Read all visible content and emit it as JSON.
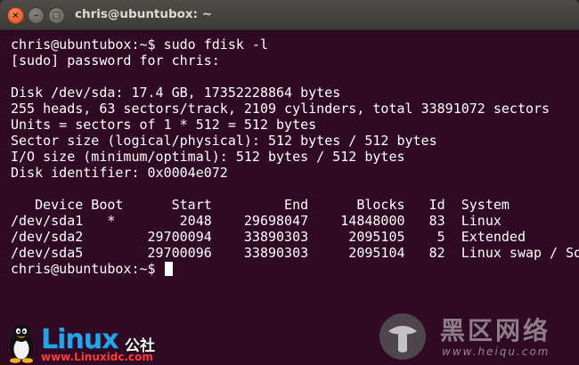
{
  "window": {
    "title": "chris@ubuntubox: ~",
    "controls": {
      "close": "×",
      "minimize": "–",
      "maximize": "□"
    }
  },
  "terminal": {
    "lines": [
      "chris@ubuntubox:~$ sudo fdisk -l",
      "[sudo] password for chris:",
      "",
      "Disk /dev/sda: 17.4 GB, 17352228864 bytes",
      "255 heads, 63 sectors/track, 2109 cylinders, total 33891072 sectors",
      "Units = sectors of 1 * 512 = 512 bytes",
      "Sector size (logical/physical): 512 bytes / 512 bytes",
      "I/O size (minimum/optimal): 512 bytes / 512 bytes",
      "Disk identifier: 0x0004e072",
      "",
      "   Device Boot      Start         End      Blocks   Id  System",
      "/dev/sda1   *        2048    29698047    14848000   83  Linux",
      "/dev/sda2        29700094    33890303     2095105    5  Extended",
      "/dev/sda5        29700096    33890303     2095104   82  Linux swap / Solaris"
    ],
    "prompt": "chris@ubuntubox:~$ "
  },
  "watermarks": {
    "linux_logo_text": "Linux",
    "linux_logo_cn": "公社",
    "linux_url": "www.Linuxidc.com",
    "heike_cn": "黑区网络",
    "heike_url": "www.heiqu.com"
  },
  "colors": {
    "terminal_bg": "#300a24",
    "terminal_fg": "#ffffff",
    "titlebar": "#3c3b37",
    "close_button": "#df4a16"
  }
}
